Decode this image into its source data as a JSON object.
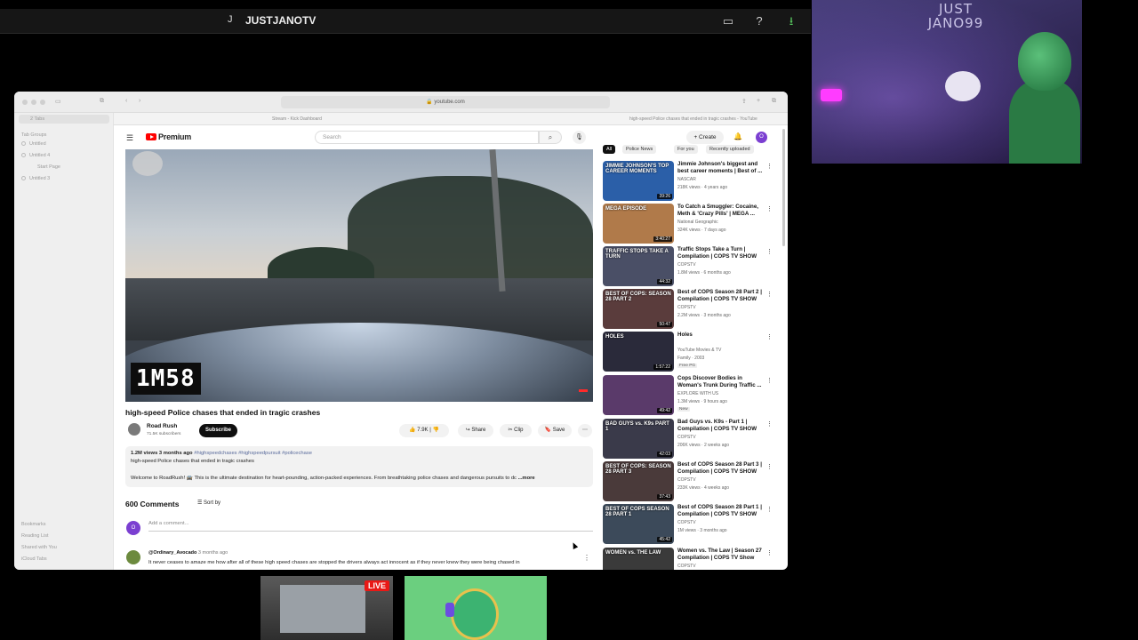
{
  "stream": {
    "initial": "J",
    "channel_name": "JUSTJANOTV",
    "webcam_sign": "JUST\nJANO99"
  },
  "browser": {
    "url": "youtube.com",
    "tab1": "Stream - Kick Dashboard",
    "tab2": "high-speed Police chases that ended in tragic crashes - YouTube",
    "sidebar": {
      "tabs_count": "2 Tabs",
      "group_header": "Tab Groups",
      "items": [
        "Untitled",
        "Untitled 4",
        "Start Page",
        "Untitled 3"
      ],
      "bottom": [
        "Bookmarks",
        "Reading List",
        "Shared with You",
        "iCloud Tabs"
      ]
    }
  },
  "youtube": {
    "logo_text": "Premium",
    "search_placeholder": "Search",
    "create_label": "+ Create",
    "avatar_letter": "O",
    "video_watermark": "1M58",
    "title": "high-speed Police chases that ended in tragic crashes",
    "channel": "Road Rush",
    "subscribers": "71.5K subscribers",
    "subscribe_label": "Subscribe",
    "likes": "7.9K",
    "share_label": "Share",
    "clip_label": "Clip",
    "save_label": "Save",
    "desc_stats": "1.2M views  3 months ago",
    "desc_tags": "#highspeedchases #highspeedpursuit #policechase",
    "desc_line2": "high-speed Police chases that ended in tragic crashes",
    "desc_line3": "Welcome to RoadRush! 🚔 This is the ultimate destination for heart-pounding, action-packed experiences. From breathtaking police chases and dangerous pursuits to dc",
    "desc_more": "...more",
    "comments_count": "600 Comments",
    "sort_label": "Sort by",
    "add_comment": "Add a comment...",
    "comment_user": "@Ordinary_Avocado",
    "comment_time": "3 months ago",
    "comment_text": "It never ceases to amaze me how after all of these high speed chases are stopped the drivers always act innocent as if they never knew they were being chased in"
  },
  "chips": [
    "All",
    "Police News",
    "For you",
    "Recently uploaded"
  ],
  "recommendations": [
    {
      "title": "Jimmie Johnson's biggest and best career moments | Best of ...",
      "channel": "NASCAR",
      "meta": "218K views · 4 years ago",
      "duration": "39:26",
      "thumb_label": "JIMMIE JOHNSON'S TOP CAREER MOMENTS",
      "badge": "",
      "color": "#2b5fa8"
    },
    {
      "title": "To Catch a Smuggler: Cocaine, Meth & 'Crazy Pills' | MEGA ...",
      "channel": "National Geographic",
      "meta": "324K views · 7 days ago",
      "duration": "3:40:27",
      "thumb_label": "MEGA EPISODE",
      "badge": "",
      "color": "#b07a4a"
    },
    {
      "title": "Traffic Stops Take a Turn | Compilation | COPS TV SHOW",
      "channel": "COPSTV",
      "meta": "1.8M views · 6 months ago",
      "duration": "44:32",
      "thumb_label": "TRAFFIC STOPS TAKE A TURN",
      "badge": "",
      "color": "#4a4f66"
    },
    {
      "title": "Best of COPS Season 28 Part 2 | Compilation | COPS TV SHOW",
      "channel": "COPSTV",
      "meta": "2.2M views · 3 months ago",
      "duration": "50:47",
      "thumb_label": "BEST OF COPS: SEASON 28 PART 2",
      "badge": "",
      "color": "#5a3c3c"
    },
    {
      "title": "Holes",
      "channel": "YouTube Movies & TV",
      "meta": "Family · 2003",
      "duration": "1:57:22",
      "thumb_label": "HOLES",
      "badge": "Free  PG",
      "color": "#2a2a3a"
    },
    {
      "title": "Cops Discover Bodies in Woman's Trunk During Traffic ...",
      "channel": "EXPLORE WITH US",
      "meta": "1.3M views · 9 hours ago",
      "duration": "49:42",
      "thumb_label": "",
      "badge": "New",
      "color": "#5a3a6a"
    },
    {
      "title": "Bad Guys vs. K9s - Part 1 | Compilation | COPS TV SHOW",
      "channel": "COPSTV",
      "meta": "206K views · 2 weeks ago",
      "duration": "42:03",
      "thumb_label": "BAD GUYS vs. K9s  PART 1",
      "badge": "",
      "color": "#3a3a4a"
    },
    {
      "title": "Best of COPS Season 28 Part 3 | Compilation | COPS TV SHOW",
      "channel": "COPSTV",
      "meta": "233K views · 4 weeks ago",
      "duration": "37:43",
      "thumb_label": "BEST OF COPS: SEASON 28 PART 3",
      "badge": "",
      "color": "#4a3a3a"
    },
    {
      "title": "Best of COPS Season 28 Part 1 | Compilation | COPS TV SHOW",
      "channel": "COPSTV",
      "meta": "1M views · 3 months ago",
      "duration": "45:42",
      "thumb_label": "BEST OF COPS SEASON 28 PART 1",
      "badge": "",
      "color": "#3c4a5a"
    },
    {
      "title": "Women vs. The Law | Season 27 Compilation | COPS TV Show",
      "channel": "COPSTV",
      "meta": "",
      "duration": "",
      "thumb_label": "WOMEN vs. THE LAW",
      "badge": "",
      "color": "#3a3a3a"
    }
  ],
  "bottom_live": "LIVE"
}
